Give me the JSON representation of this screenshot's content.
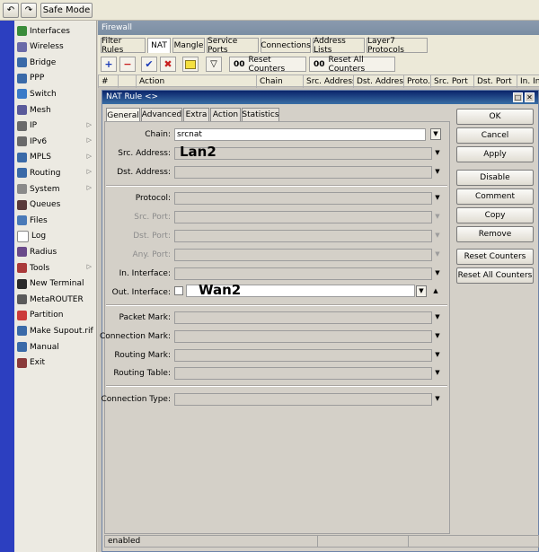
{
  "toolbar": {
    "undo_icon": "undo-icon",
    "redo_icon": "redo-icon",
    "safe_mode": "Safe Mode"
  },
  "sidebar": {
    "items": [
      {
        "label": "Interfaces",
        "icon": "interfaces-icon",
        "color": "#3a8c3a",
        "arrow": false
      },
      {
        "label": "Wireless",
        "icon": "wireless-icon",
        "color": "#6a6aa8",
        "arrow": false
      },
      {
        "label": "Bridge",
        "icon": "bridge-icon",
        "color": "#3a6aa8",
        "arrow": false
      },
      {
        "label": "PPP",
        "icon": "ppp-icon",
        "color": "#3a6aa8",
        "arrow": false
      },
      {
        "label": "Switch",
        "icon": "switch-icon",
        "color": "#3a7ac8",
        "arrow": false
      },
      {
        "label": "Mesh",
        "icon": "mesh-icon",
        "color": "#5a5a9a",
        "arrow": false
      },
      {
        "label": "IP",
        "icon": "ip-icon",
        "color": "#6a6a6a",
        "arrow": true
      },
      {
        "label": "IPv6",
        "icon": "ipv6-icon",
        "color": "#6a6a6a",
        "arrow": true
      },
      {
        "label": "MPLS",
        "icon": "mpls-icon",
        "color": "#3a6aa8",
        "arrow": true
      },
      {
        "label": "Routing",
        "icon": "routing-icon",
        "color": "#3a6aa8",
        "arrow": true
      },
      {
        "label": "System",
        "icon": "system-icon",
        "color": "#8a8a8a",
        "arrow": true
      },
      {
        "label": "Queues",
        "icon": "queues-icon",
        "color": "#5a3a3a",
        "arrow": false
      },
      {
        "label": "Files",
        "icon": "files-icon",
        "color": "#4a7ab8",
        "arrow": false
      },
      {
        "label": "Log",
        "icon": "log-icon",
        "color": "#ffffff",
        "arrow": false
      },
      {
        "label": "Radius",
        "icon": "radius-icon",
        "color": "#6a4a8a",
        "arrow": false
      },
      {
        "label": "Tools",
        "icon": "tools-icon",
        "color": "#aa3a3a",
        "arrow": true
      },
      {
        "label": "New Terminal",
        "icon": "terminal-icon",
        "color": "#2a2a2a",
        "arrow": false
      },
      {
        "label": "MetaROUTER",
        "icon": "metarouter-icon",
        "color": "#5a5a5a",
        "arrow": false
      },
      {
        "label": "Partition",
        "icon": "partition-icon",
        "color": "#cc3a3a",
        "arrow": false
      },
      {
        "label": "Make Supout.rif",
        "icon": "supout-icon",
        "color": "#3a6aa8",
        "arrow": false
      },
      {
        "label": "Manual",
        "icon": "manual-icon",
        "color": "#3a6aa8",
        "arrow": false
      },
      {
        "label": "Exit",
        "icon": "exit-icon",
        "color": "#8a3a3a",
        "arrow": false
      }
    ]
  },
  "firewall": {
    "title": "Firewall",
    "tabs": [
      "Filter Rules",
      "NAT",
      "Mangle",
      "Service Ports",
      "Connections",
      "Address Lists",
      "Layer7 Protocols"
    ],
    "active_tab": "NAT",
    "reset_counters": "Reset Counters",
    "reset_all_counters": "Reset All Counters",
    "columns": [
      "#",
      "",
      "Action",
      "Chain",
      "Src. Address",
      "Dst. Address",
      "Proto...",
      "Src. Port",
      "Dst. Port",
      "In. In"
    ]
  },
  "dialog": {
    "title": "NAT Rule <>",
    "tabs": [
      "General",
      "Advanced",
      "Extra",
      "Action",
      "Statistics"
    ],
    "active_tab": "General",
    "fields": {
      "chain": {
        "label": "Chain:",
        "value": "srcnat"
      },
      "src_address": {
        "label": "Src. Address:",
        "value": "Lan2"
      },
      "dst_address": {
        "label": "Dst. Address:"
      },
      "protocol": {
        "label": "Protocol:"
      },
      "src_port": {
        "label": "Src. Port:"
      },
      "dst_port": {
        "label": "Dst. Port:"
      },
      "any_port": {
        "label": "Any. Port:"
      },
      "in_interface": {
        "label": "In. Interface:"
      },
      "out_interface": {
        "label": "Out. Interface:",
        "value": "Wan2"
      },
      "packet_mark": {
        "label": "Packet Mark:"
      },
      "connection_mark": {
        "label": "Connection Mark:"
      },
      "routing_mark": {
        "label": "Routing Mark:"
      },
      "routing_table": {
        "label": "Routing Table:"
      },
      "connection_type": {
        "label": "Connection Type:"
      }
    },
    "buttons": {
      "ok": "OK",
      "cancel": "Cancel",
      "apply": "Apply",
      "disable": "Disable",
      "comment": "Comment",
      "copy": "Copy",
      "remove": "Remove",
      "reset_counters": "Reset Counters",
      "reset_all_counters": "Reset All Counters"
    },
    "status": "enabled"
  }
}
